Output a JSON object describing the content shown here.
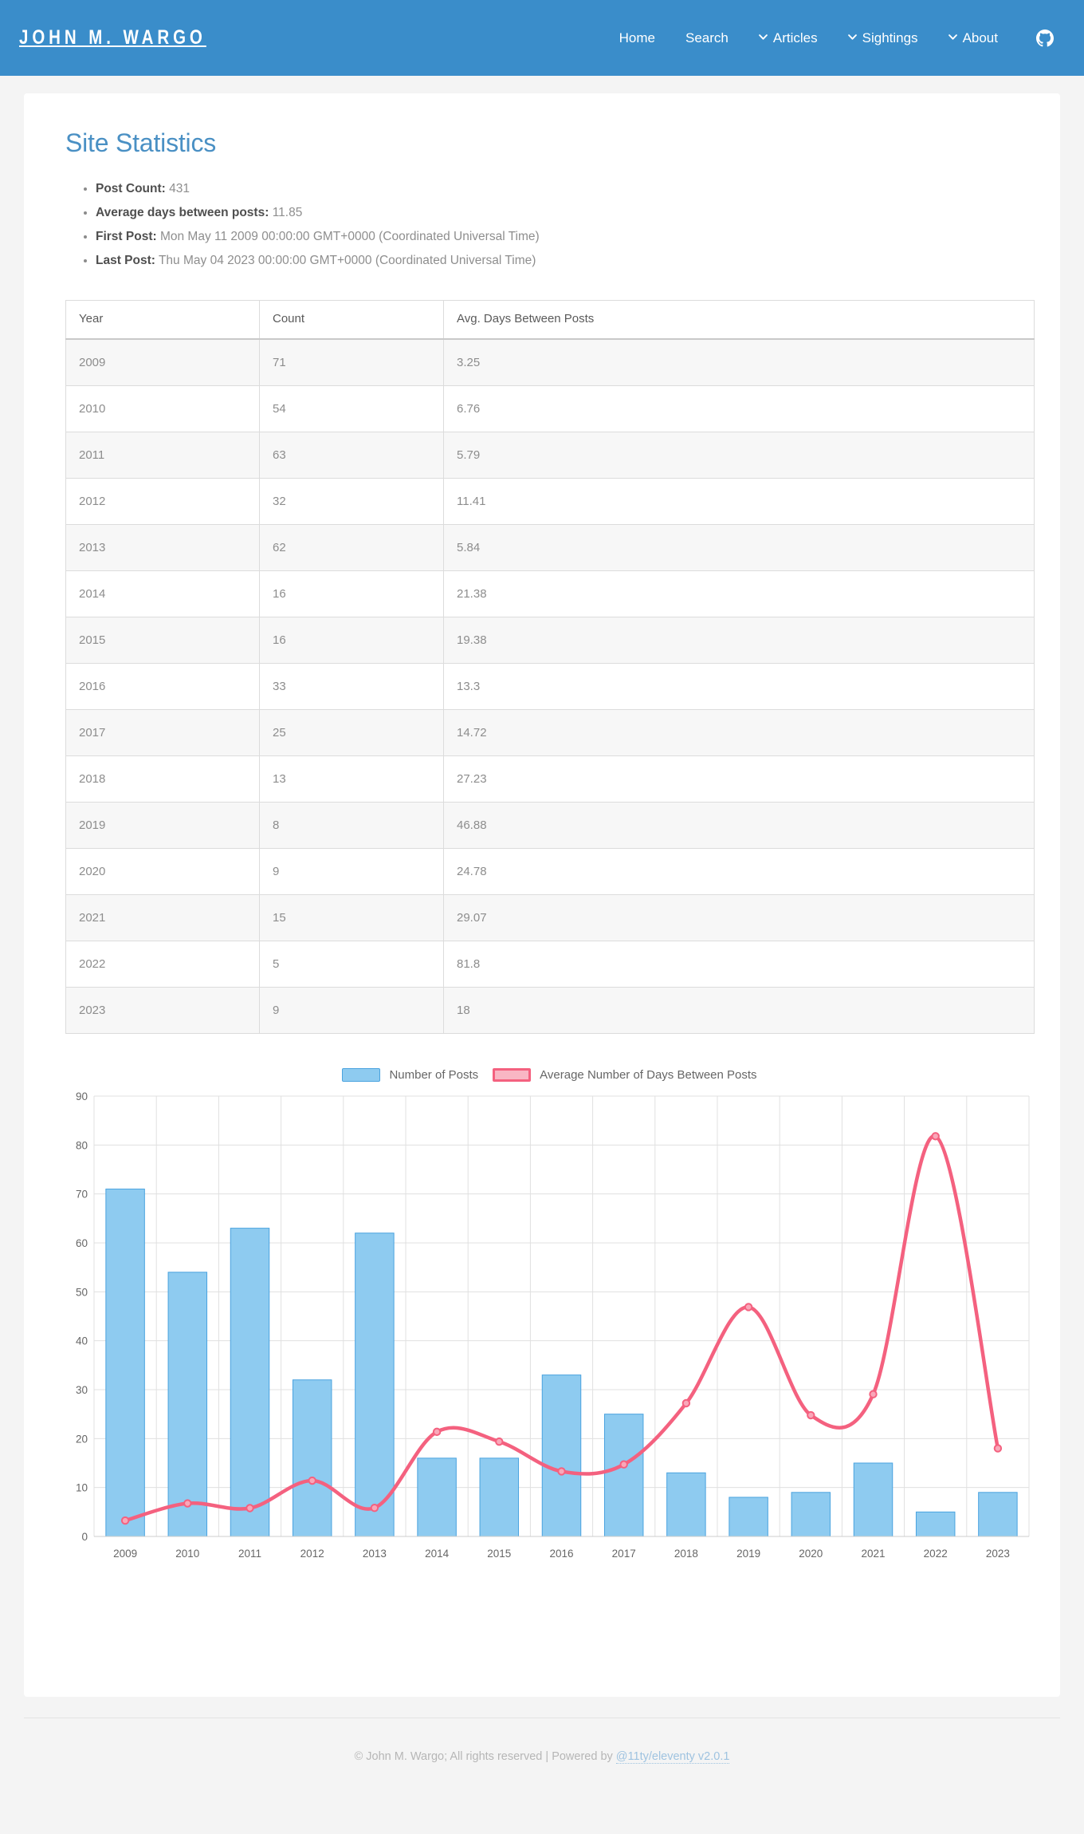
{
  "nav": {
    "brand": "JOHN M. WARGO",
    "items": [
      {
        "label": "Home",
        "has_caret": false
      },
      {
        "label": "Search",
        "has_caret": false
      },
      {
        "label": "Articles",
        "has_caret": true
      },
      {
        "label": "Sightings",
        "has_caret": true
      },
      {
        "label": "About",
        "has_caret": true
      }
    ],
    "github_icon": "github-icon"
  },
  "main": {
    "title": "Site Statistics",
    "stats": [
      {
        "label": "Post Count:",
        "value": "431"
      },
      {
        "label": "Average days between posts:",
        "value": "11.85"
      },
      {
        "label": "First Post:",
        "value": "Mon May 11 2009 00:00:00 GMT+0000 (Coordinated Universal Time)"
      },
      {
        "label": "Last Post:",
        "value": "Thu May 04 2023 00:00:00 GMT+0000 (Coordinated Universal Time)"
      }
    ],
    "table": {
      "headers": [
        "Year",
        "Count",
        "Avg. Days Between Posts"
      ],
      "rows": [
        [
          "2009",
          "71",
          "3.25"
        ],
        [
          "2010",
          "54",
          "6.76"
        ],
        [
          "2011",
          "63",
          "5.79"
        ],
        [
          "2012",
          "32",
          "11.41"
        ],
        [
          "2013",
          "62",
          "5.84"
        ],
        [
          "2014",
          "16",
          "21.38"
        ],
        [
          "2015",
          "16",
          "19.38"
        ],
        [
          "2016",
          "33",
          "13.3"
        ],
        [
          "2017",
          "25",
          "14.72"
        ],
        [
          "2018",
          "13",
          "27.23"
        ],
        [
          "2019",
          "8",
          "46.88"
        ],
        [
          "2020",
          "9",
          "24.78"
        ],
        [
          "2021",
          "15",
          "29.07"
        ],
        [
          "2022",
          "5",
          "81.8"
        ],
        [
          "2023",
          "9",
          "18"
        ]
      ]
    }
  },
  "chart_data": {
    "type": "bar",
    "title": "",
    "xlabel": "",
    "ylabel": "",
    "ylim": [
      0,
      90
    ],
    "yticks": [
      0,
      10,
      20,
      30,
      40,
      50,
      60,
      70,
      80,
      90
    ],
    "grid": true,
    "legend_position": "top",
    "categories": [
      "2009",
      "2010",
      "2011",
      "2012",
      "2013",
      "2014",
      "2015",
      "2016",
      "2017",
      "2018",
      "2019",
      "2020",
      "2021",
      "2022",
      "2023"
    ],
    "series": [
      {
        "name": "Number of Posts",
        "type": "bar",
        "color": "#8ecbf0",
        "border_color": "#4aa3df",
        "values": [
          71,
          54,
          63,
          32,
          62,
          16,
          16,
          33,
          25,
          13,
          8,
          9,
          15,
          5,
          9
        ]
      },
      {
        "name": "Average Number of Days Between Posts",
        "type": "line",
        "color": "#f4617f",
        "values": [
          3.25,
          6.76,
          5.79,
          11.41,
          5.84,
          21.38,
          19.38,
          13.3,
          14.72,
          27.23,
          46.88,
          24.78,
          29.07,
          81.8,
          18
        ]
      }
    ]
  },
  "footer": {
    "copyright": "© John M. Wargo; All rights reserved | Powered by ",
    "link_label": "@11ty/eleventy v2.0.1"
  }
}
